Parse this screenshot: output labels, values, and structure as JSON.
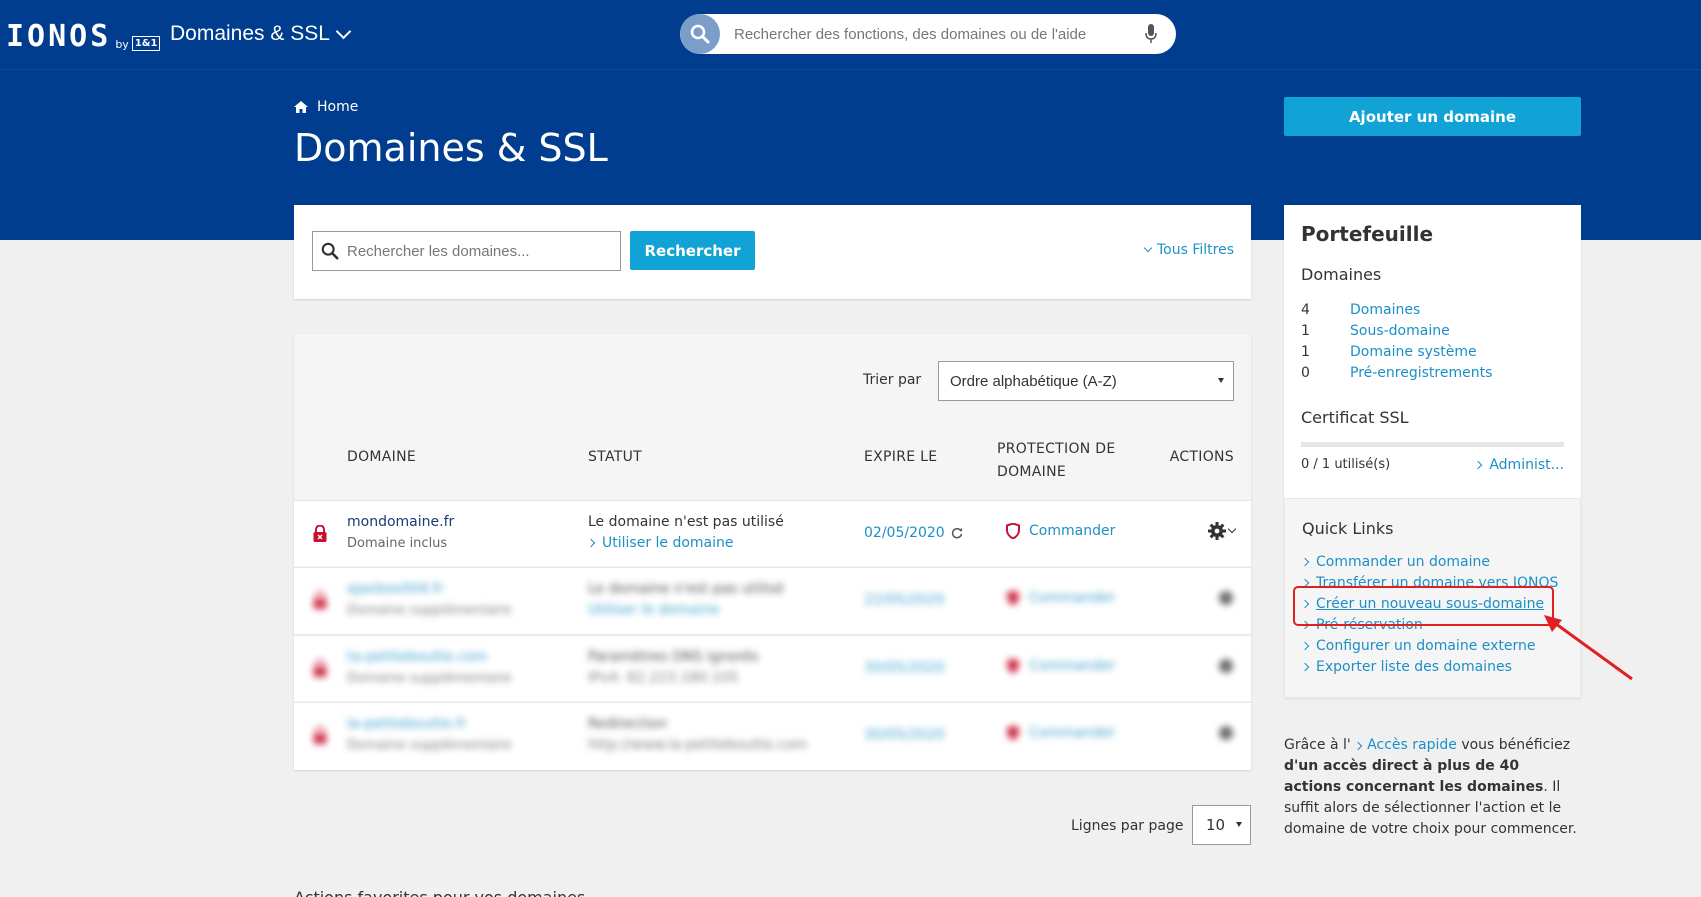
{
  "header": {
    "logo_text": "IONOS",
    "logo_by": "by",
    "logo_badge": "1&1",
    "app_name": "Domaines & SSL",
    "search_placeholder": "Rechercher des fonctions, des domaines ou de l'aide"
  },
  "breadcrumb": {
    "home_label": "Home"
  },
  "page": {
    "title": "Domaines & SSL",
    "add_domain_label": "Ajouter un domaine"
  },
  "domain_search": {
    "placeholder": "Rechercher les domaines...",
    "button_label": "Rechercher",
    "filters_label": "Tous Filtres"
  },
  "table": {
    "sort_label": "Trier par",
    "sort_value": "Ordre alphabétique (A-Z)",
    "columns": {
      "domain": "DOMAINE",
      "status": "STATUT",
      "expires": "EXPIRE LE",
      "protection_line1": "PROTECTION DE",
      "protection_line2": "DOMAINE",
      "actions": "ACTIONS"
    },
    "rows": [
      {
        "domain": "mondomaine.fr",
        "subtitle": "Domaine inclus",
        "status": "Le domaine n'est pas utilisé",
        "status_link": "Utiliser le domaine",
        "expires": "02/05/2020",
        "protection": "Commander"
      },
      {
        "domain": "ajaxbox004.fr",
        "subtitle": "Domaine supplémentaire",
        "status": "Le domaine n'est pas utilisé",
        "status_link": "Utiliser le domaine",
        "expires": "22/05/2020",
        "protection": "Commander"
      },
      {
        "domain": "ta-petiteboutte.com",
        "subtitle": "Domaine supplémentaire",
        "status": "Paramètres DNS ignorés",
        "status_link": "IPv4: 82.223.180.105",
        "expires": "30/05/2020",
        "protection": "Commander"
      },
      {
        "domain": "la-petiteboutte.fr",
        "subtitle": "Domaine supplémentaire",
        "status": "Redirection",
        "status_link": "http://www.la-petiteboutte.com",
        "expires": "30/05/2020",
        "protection": "Commander"
      }
    ],
    "rows_per_page_label": "Lignes par page",
    "rows_per_page_value": "10",
    "bottom_text": "Actions favorites pour vos domaines"
  },
  "portfolio": {
    "title": "Portefeuille",
    "domains_heading": "Domaines",
    "counts": [
      {
        "count": "4",
        "label": "Domaines"
      },
      {
        "count": "1",
        "label": "Sous-domaine"
      },
      {
        "count": "1",
        "label": "Domaine système"
      },
      {
        "count": "0",
        "label": "Pré-enregistrements"
      }
    ],
    "ssl_heading": "Certificat SSL",
    "ssl_used": "0 / 1 utilisé(s)",
    "ssl_used_fraction": 0,
    "ssl_manage": "Administ..."
  },
  "quick_links": {
    "title": "Quick Links",
    "items": [
      "Commander un domaine",
      "Transférer un domaine vers IONOS",
      "Créer un nouveau sous-domaine",
      "Pré-réservation",
      "Configurer un domaine externe",
      "Exporter liste des domaines"
    ]
  },
  "info": {
    "prefix": "Grâce à l'",
    "link": "Accès rapide",
    "middle": " vous bénéficiez ",
    "bold": "d'un accès direct à plus de 40 actions concernant les domaines",
    "suffix": ". Il suffit alors de sélectionner l'action et le domaine de votre choix pour commencer."
  },
  "colors": {
    "header_blue": "#003d8f",
    "accent": "#12a3d6",
    "link": "#1c8fc7",
    "lock_red": "#c8102e",
    "annotation_red": "#e02020"
  }
}
